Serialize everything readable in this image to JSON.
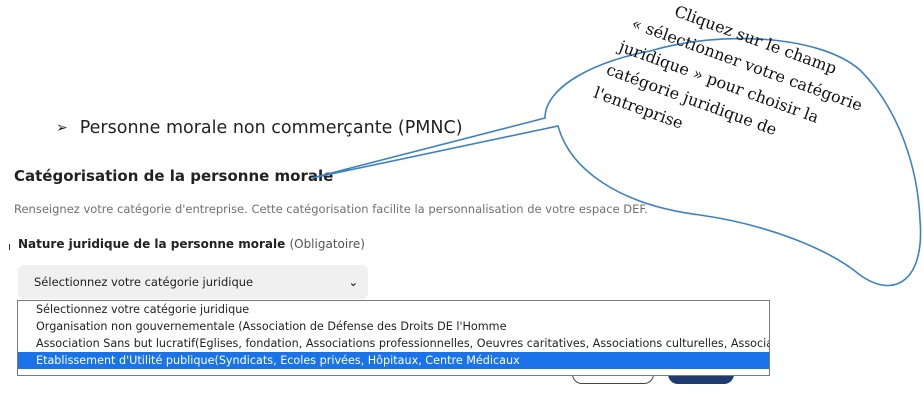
{
  "bullet": {
    "arrow": "➢",
    "text": "Personne morale non commerçante (PMNC)"
  },
  "section": {
    "title": "Catégorisation de la personne morale",
    "description": "Renseignez votre catégorie d'entreprise. Cette catégorisation facilite la personnalisation de votre espace DEF."
  },
  "field": {
    "label": "Nature juridique de la personne morale",
    "required": "(Obligatoire)",
    "selected_value": "Sélectionnez votre catégorie juridique",
    "chevron": "⌄",
    "options": [
      "Sélectionnez votre catégorie juridique",
      "Organisation non gouvernementale (Association de Défense des Droits DE l'Homme",
      "Association Sans but lucratif(Eglises, fondation, Associations professionnelles, Oeuvres caritatives, Associations culturelles, Associations diverses",
      "Etablissement d'Utilité publique(Syndicats, Ecoles privées, Hôpitaux, Centre Médicaux"
    ],
    "highlighted_index": 3
  },
  "callout": {
    "lines": [
      "Cliquez sur le champ",
      "« sélectionner votre catégorie",
      "juridique » pour choisir la",
      "catégorie juridique de",
      "l'entreprise"
    ],
    "stroke_color": "#3b82c4"
  },
  "colors": {
    "highlight": "#1a73e8",
    "primary_button": "#1f3b6f"
  }
}
